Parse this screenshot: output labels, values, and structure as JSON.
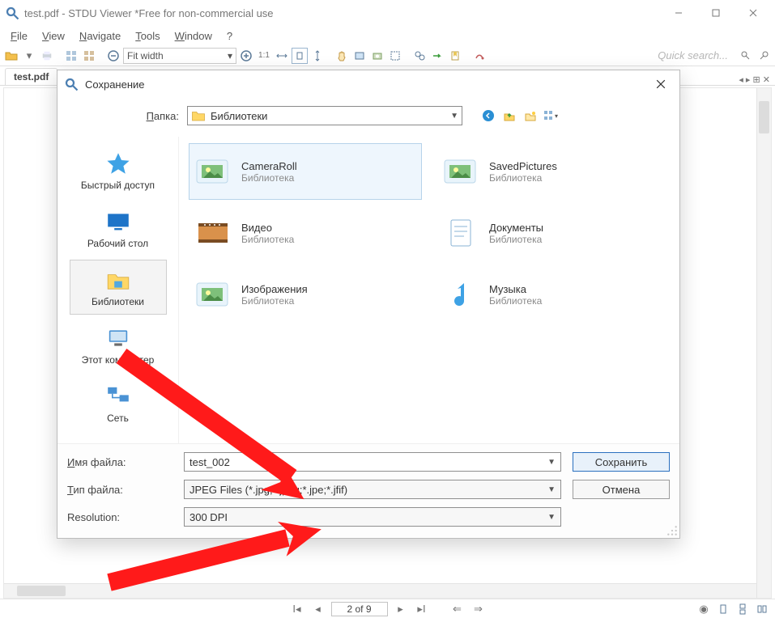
{
  "window": {
    "title": "test.pdf - STDU Viewer *Free for non-commercial use"
  },
  "menu": {
    "file": "File",
    "view": "View",
    "navigate": "Navigate",
    "tools": "Tools",
    "window": "Window",
    "help": "?"
  },
  "toolbar": {
    "zoom_mode": "Fit width",
    "quick_search_placeholder": "Quick search..."
  },
  "tabs": {
    "active": "test.pdf"
  },
  "pagebar": {
    "current_of_total": "2 of 9"
  },
  "dialog": {
    "title": "Сохранение",
    "lookin_label": "Папка:",
    "lookin_value": "Библиотеки",
    "places": [
      {
        "label": "Быстрый доступ"
      },
      {
        "label": "Рабочий стол"
      },
      {
        "label": "Библиотеки"
      },
      {
        "label": "Этот компьютер"
      },
      {
        "label": "Сеть"
      }
    ],
    "items": [
      {
        "name": "CameraRoll",
        "sub": "Библиотека"
      },
      {
        "name": "SavedPictures",
        "sub": "Библиотека"
      },
      {
        "name": "Видео",
        "sub": "Библиотека"
      },
      {
        "name": "Документы",
        "sub": "Библиотека"
      },
      {
        "name": "Изображения",
        "sub": "Библиотека"
      },
      {
        "name": "Музыка",
        "sub": "Библиотека"
      }
    ],
    "filename_label": "Имя файла:",
    "filename_value": "test_002",
    "filetype_label": "Тип файла:",
    "filetype_value": "JPEG Files (*.jpg;*.jpeg;*.jpe;*.jfif)",
    "resolution_label": "Resolution:",
    "resolution_value": "300 DPI",
    "save_btn": "Сохранить",
    "cancel_btn": "Отмена"
  }
}
